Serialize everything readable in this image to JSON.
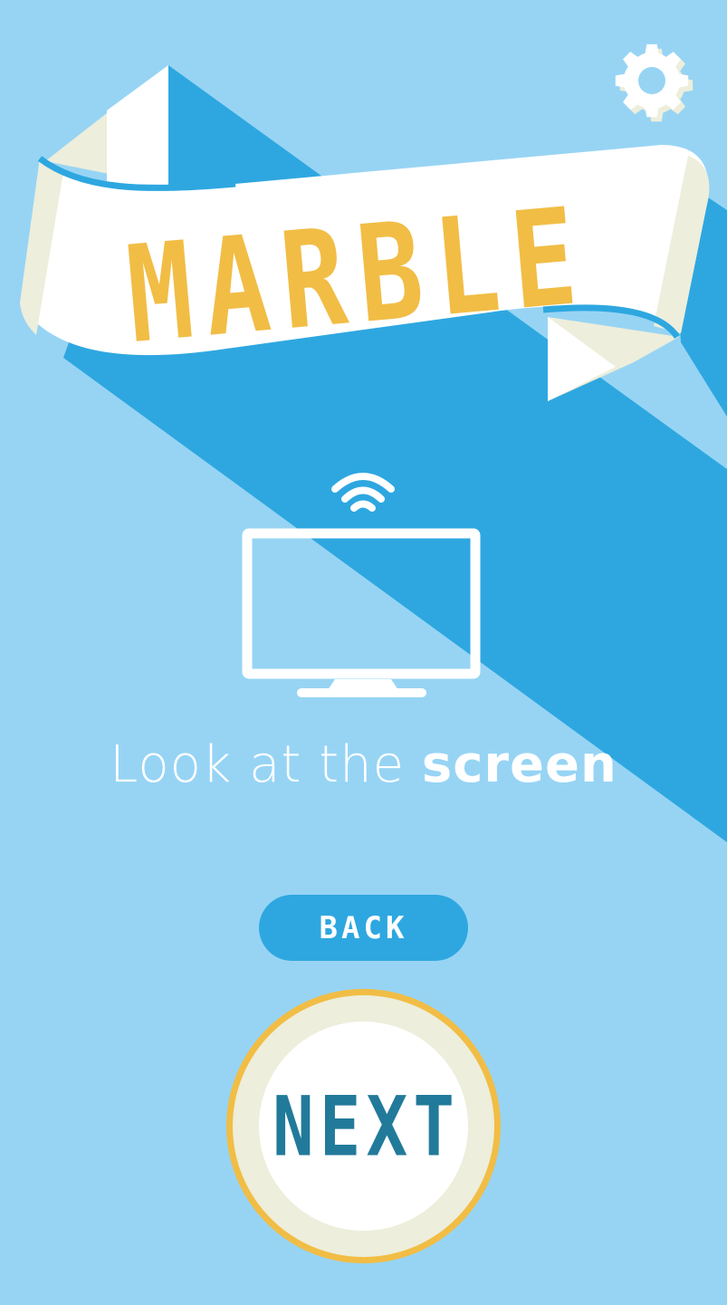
{
  "app": {
    "title": "MARBLE"
  },
  "instruction": {
    "prefix": "Look at the ",
    "emphasis": "screen"
  },
  "buttons": {
    "back_label": "BACK",
    "next_label": "NEXT"
  },
  "icons": {
    "settings": "gear-icon",
    "screen": "tv-screen-icon",
    "cast": "wifi-signal-icon"
  },
  "colors": {
    "background": "#97d4f4",
    "diagonal_band": "#2ea7e0",
    "title": "#f1bd45",
    "next_text": "#227a9a",
    "ribbon": "#ffffff",
    "ribbon_fold": "#edeedb"
  }
}
